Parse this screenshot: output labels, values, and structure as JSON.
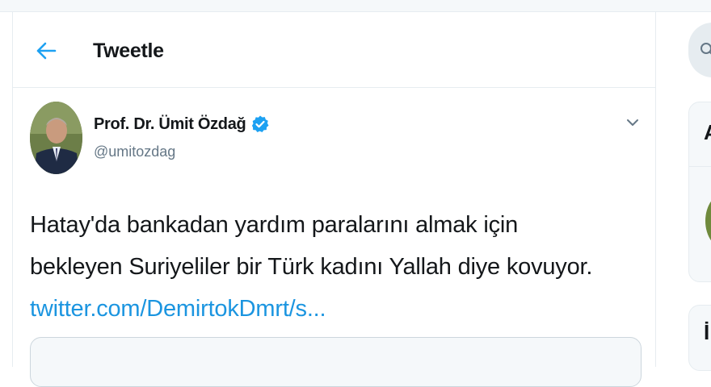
{
  "header": {
    "title": "Tweetle"
  },
  "tweet": {
    "author_name": "Prof. Dr. Ümit Özdağ",
    "handle": "@umitozdag",
    "text_line1": "Hatay'da bankadan yardım paralarını almak için",
    "text_line2": "bekleyen Suriyeliler bir Türk kadını Yallah diye kovuyor.",
    "link_text": "twitter.com/DemirtokDmrt/s..."
  },
  "right_column": {
    "panel1_title": "A",
    "panel2_title": "İ"
  },
  "colors": {
    "accent": "#1da1f2",
    "link": "#1b95e0",
    "border": "#e6ecf0",
    "muted": "#657786"
  }
}
